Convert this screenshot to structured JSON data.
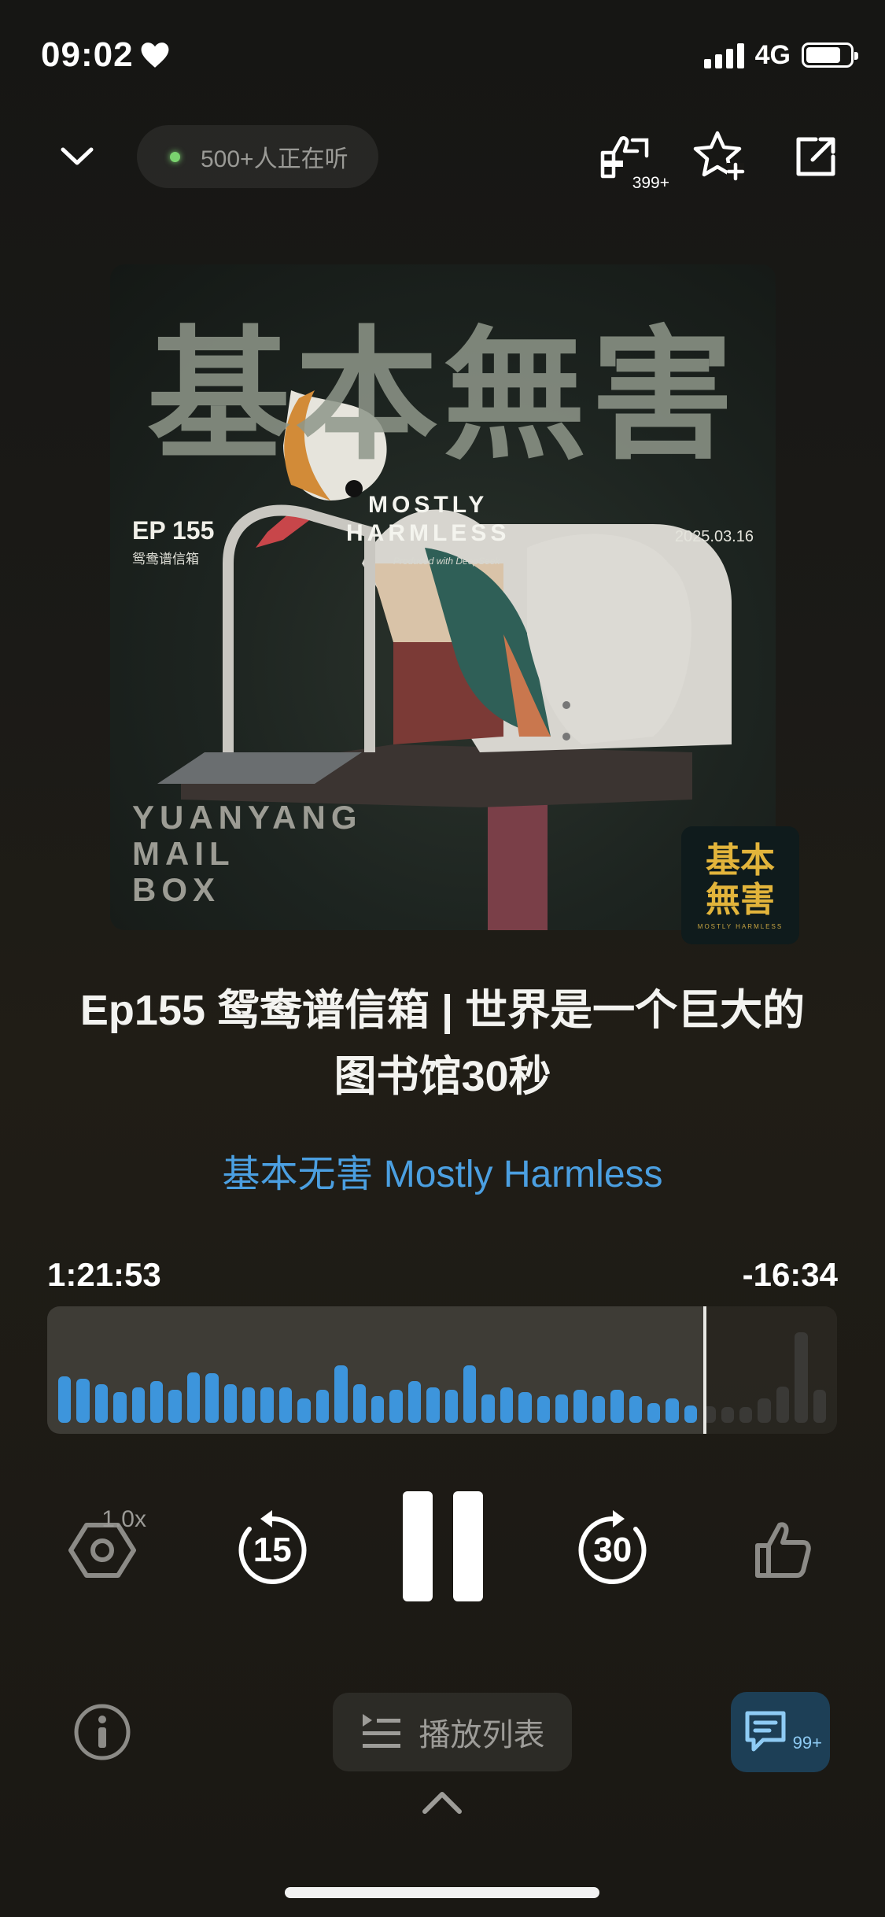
{
  "status": {
    "time": "09:02",
    "network": "4G",
    "battery_level": 0.8
  },
  "top_bar": {
    "listeners_text": "500+人正在听",
    "share_count": "399+"
  },
  "artwork": {
    "title": "基本無害",
    "ep": "EP 155",
    "ep_sub": "鸳鸯谱信箱",
    "brand_line1": "MOSTLY",
    "brand_line2": "HARMLESS",
    "brand_sub": "Produced with DeepSeek",
    "date": "2025.03.16",
    "caption_1": "YUANYANG",
    "caption_2": "MAIL",
    "caption_3": "BOX",
    "logo_line1": "基本",
    "logo_line2": "無害",
    "logo_sub": "MOSTLY HARMLESS"
  },
  "episode": {
    "title": "Ep155 鸳鸯谱信箱 | 世界是一个巨大的图书馆30秒",
    "podcast": "基本无害 Mostly Harmless"
  },
  "playback": {
    "elapsed": "1:21:53",
    "remaining": "-16:34",
    "progress": 0.833,
    "waveform": [
      0.42,
      0.4,
      0.35,
      0.28,
      0.32,
      0.38,
      0.3,
      0.46,
      0.45,
      0.35,
      0.32,
      0.32,
      0.32,
      0.22,
      0.3,
      0.52,
      0.35,
      0.24,
      0.3,
      0.38,
      0.32,
      0.3,
      0.52,
      0.26,
      0.32,
      0.28,
      0.24,
      0.26,
      0.3,
      0.24,
      0.3,
      0.24,
      0.18,
      0.22,
      0.16,
      0.15,
      0.14,
      0.14,
      0.22,
      0.33,
      0.82,
      0.3
    ],
    "speed": "1.0x",
    "rewind": "15",
    "forward": "30"
  },
  "bottom": {
    "playlist_label": "播放列表",
    "comments_count": "99+"
  },
  "colors": {
    "accent": "#4b9fe1",
    "wave_played": "#3d95dc",
    "wave_remaining": "#3a3936"
  }
}
